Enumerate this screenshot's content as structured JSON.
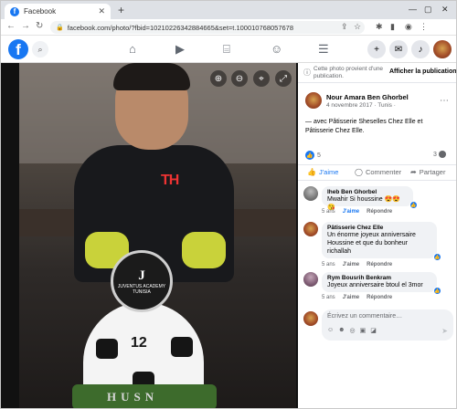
{
  "browser": {
    "tab_title": "Facebook",
    "tab_close": "✕",
    "new_tab": "+",
    "url": "facebook.com/photo/?fbid=10210226342884665&set=t.100010768057678",
    "window_controls": [
      "—",
      "▢",
      "✕"
    ]
  },
  "fb": {
    "logo": "f",
    "nav_icons": [
      "home-icon",
      "watch-icon",
      "marketplace-icon",
      "groups-icon",
      "menu-icon"
    ]
  },
  "panel": {
    "notice_text": "Cette photo provient d'une publication.",
    "notice_button": "Afficher la publication",
    "author_name": "Nour Amara Ben Ghorbel",
    "post_meta": "4 novembre 2017 · Tunis ·",
    "caption": "— avec Pâtisserie Sheselles Chez Elle et Pâtisserie Chez Elle.",
    "reaction_count": "5",
    "comment_count": "3",
    "actions": {
      "like": "J'aime",
      "comment": "Commenter",
      "share": "Partager"
    },
    "comments": [
      {
        "name": "Iheb Ben Ghorbel",
        "text": "Mwahir Si houssine 😍😍😘",
        "time": "5 ans",
        "like": "J'aime",
        "reply": "Répondre",
        "reactions": "1"
      },
      {
        "name": "Pâtisserie Chez Elle",
        "text": "Un énorme joyeux anniversaire Houssine et que du bonheur richallah",
        "time": "5 ans",
        "like": "J'aime",
        "reply": "Répondre",
        "reactions": "1"
      },
      {
        "name": "Rym Bousrih Benkram",
        "text": "Joyeux anniversaire btoul el 3mor",
        "time": "5 ans",
        "like": "J'aime",
        "reply": "Répondre",
        "reactions": "1"
      }
    ],
    "write_placeholder": "Écrivez un commentaire…"
  },
  "photo": {
    "shirt_text": "TH",
    "plaque_letter": "J",
    "plaque_text": "JUVENTUS ACADEMY TUNISIA",
    "cake_number": "12",
    "cake_name": "HUSN"
  },
  "colors": {
    "facebook_blue": "#1877f2",
    "panel_bg": "#ffffff",
    "photo_bg": "#111111"
  }
}
